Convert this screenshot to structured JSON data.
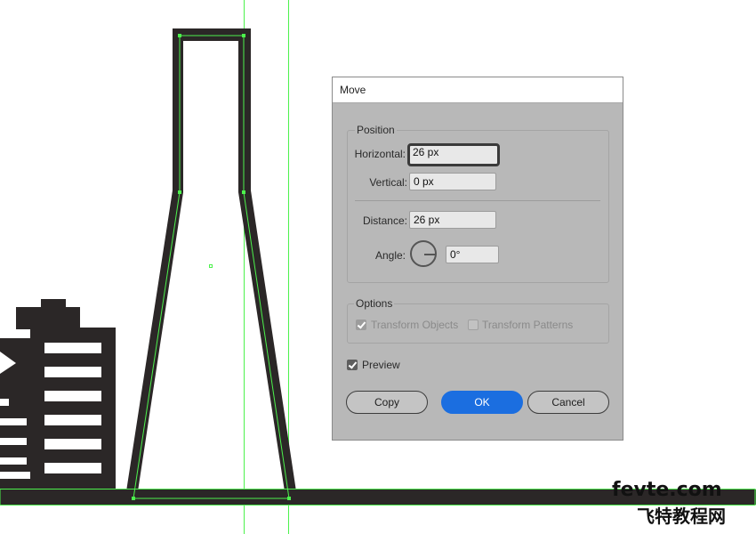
{
  "dialog": {
    "title": "Move",
    "position": {
      "group_label": "Position",
      "horizontal_label": "Horizontal:",
      "horizontal_value": "26 px",
      "vertical_label": "Vertical:",
      "vertical_value": "0 px",
      "distance_label": "Distance:",
      "distance_value": "26 px",
      "angle_label": "Angle:",
      "angle_value": "0°"
    },
    "options": {
      "group_label": "Options",
      "transform_objects_label": "Transform Objects",
      "transform_objects_checked": true,
      "transform_patterns_label": "Transform Patterns",
      "transform_patterns_checked": false
    },
    "preview_label": "Preview",
    "preview_checked": true,
    "buttons": {
      "copy": "Copy",
      "ok": "OK",
      "cancel": "Cancel"
    }
  },
  "watermark": {
    "latin": "fevte.com",
    "chinese": "飞特教程网"
  },
  "colors": {
    "artwork": "#2b2727",
    "guide": "#4cf24c",
    "ok_button": "#1b6ee0",
    "dialog_bg": "#b8b8b8"
  }
}
